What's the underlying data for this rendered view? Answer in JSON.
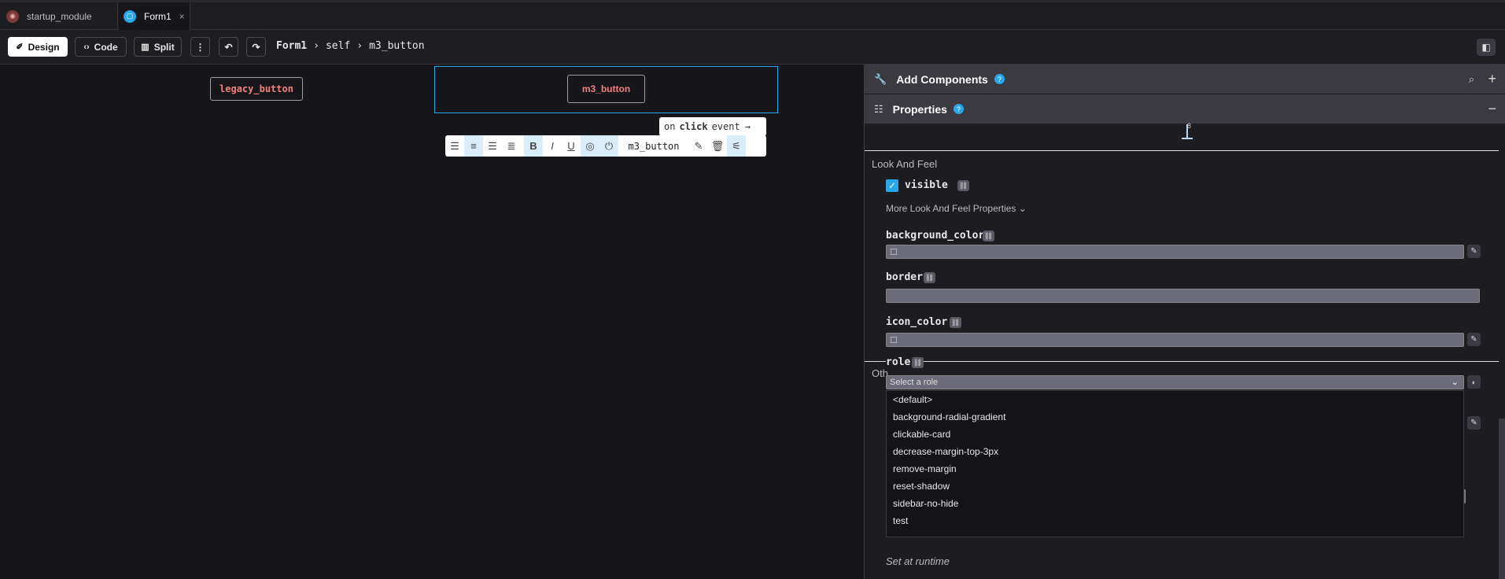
{
  "tabs": [
    {
      "label": "startup_module"
    },
    {
      "label": "Form1"
    }
  ],
  "toolbar": {
    "design": "Design",
    "code": "Code",
    "split": "Split",
    "more": "⋮",
    "undo": "↶",
    "redo": "↷"
  },
  "breadcrumb": [
    "Form1",
    "›",
    "self",
    "›",
    "m3_button"
  ],
  "canvas": {
    "legacy_button": "legacy_button",
    "m3_button": "m3_button",
    "event_chip": {
      "pre": "on",
      "event": "click",
      "post": "event"
    },
    "format_name": "m3_button"
  },
  "panel": {
    "add_components": "Add Components",
    "properties": "Properties",
    "spacing_value": "8",
    "look_and_feel": "Look And Feel",
    "visible_label": "visible",
    "visible_checked": true,
    "more_laf": "More Look And Feel Properties",
    "background_color": "background_color",
    "border": "border",
    "icon_color": "icon_color",
    "role": "role",
    "role_placeholder": "Select a role",
    "role_options": [
      "<default>",
      "background-radial-gradient",
      "clickable-card",
      "decrease-margin-top-3px",
      "remove-margin",
      "reset-shadow",
      "sidebar-no-hide",
      "test"
    ],
    "other_label": "Oth",
    "runtime": "Set at runtime"
  },
  "colors": {
    "accent": "#2aa7e8",
    "button_text": "#f08080",
    "panel_header": "#3a3a40"
  }
}
